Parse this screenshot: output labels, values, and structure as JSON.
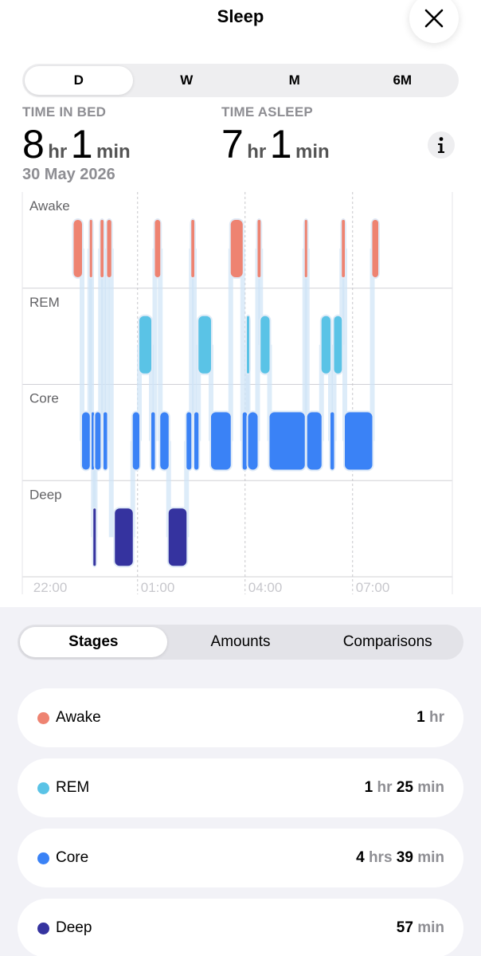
{
  "header": {
    "title": "Sleep",
    "close_icon": "close-icon"
  },
  "range_tabs": [
    {
      "label": "D",
      "active": true
    },
    {
      "label": "W",
      "active": false
    },
    {
      "label": "M",
      "active": false
    },
    {
      "label": "6M",
      "active": false
    }
  ],
  "summary": {
    "time_in_bed_label": "TIME IN BED",
    "time_in_bed_hours": "8",
    "time_in_bed_minutes": "1",
    "time_asleep_label": "TIME ASLEEP",
    "time_asleep_hours": "7",
    "time_asleep_minutes": "1",
    "unit_hr": "hr",
    "unit_min": "min",
    "date": "30 May 2026",
    "info_icon": "info-icon"
  },
  "chart_data": {
    "type": "timeline",
    "stages": [
      "Awake",
      "REM",
      "Core",
      "Deep"
    ],
    "x_ticks": [
      "22:00",
      "01:00",
      "04:00",
      "07:00"
    ],
    "colors": {
      "Awake": "#ee8371",
      "REM": "#5ac3e6",
      "Core": "#3a82f6",
      "Deep": "#35339f"
    },
    "segments": [
      {
        "stage": "Awake",
        "start": "23:13",
        "end": "23:27"
      },
      {
        "stage": "Core",
        "start": "23:27",
        "end": "23:40"
      },
      {
        "stage": "Awake",
        "start": "23:40",
        "end": "23:43"
      },
      {
        "stage": "Core",
        "start": "23:43",
        "end": "23:46"
      },
      {
        "stage": "Deep",
        "start": "23:46",
        "end": "23:49"
      },
      {
        "stage": "Core",
        "start": "23:49",
        "end": "23:58"
      },
      {
        "stage": "Awake",
        "start": "23:58",
        "end": "24:03"
      },
      {
        "stage": "Core",
        "start": "24:03",
        "end": "24:09"
      },
      {
        "stage": "Awake",
        "start": "24:09",
        "end": "24:16"
      },
      {
        "stage": "Deep",
        "start": "24:22",
        "end": "24:52"
      },
      {
        "stage": "Core",
        "start": "24:52",
        "end": "25:03"
      },
      {
        "stage": "REM",
        "start": "25:03",
        "end": "25:23"
      },
      {
        "stage": "Core",
        "start": "25:23",
        "end": "25:29"
      },
      {
        "stage": "Awake",
        "start": "25:29",
        "end": "25:38"
      },
      {
        "stage": "Core",
        "start": "25:38",
        "end": "25:52"
      },
      {
        "stage": "Deep",
        "start": "25:52",
        "end": "26:22"
      },
      {
        "stage": "Core",
        "start": "26:22",
        "end": "26:30"
      },
      {
        "stage": "Awake",
        "start": "26:30",
        "end": "26:35"
      },
      {
        "stage": "Core",
        "start": "26:35",
        "end": "26:42"
      },
      {
        "stage": "REM",
        "start": "26:42",
        "end": "27:03"
      },
      {
        "stage": "Core",
        "start": "27:03",
        "end": "27:36"
      },
      {
        "stage": "Awake",
        "start": "27:36",
        "end": "27:56"
      },
      {
        "stage": "Core",
        "start": "27:56",
        "end": "28:03"
      },
      {
        "stage": "REM",
        "start": "28:03",
        "end": "28:05"
      },
      {
        "stage": "Core",
        "start": "28:05",
        "end": "28:21"
      },
      {
        "stage": "Awake",
        "start": "28:21",
        "end": "28:26"
      },
      {
        "stage": "REM",
        "start": "28:26",
        "end": "28:41"
      },
      {
        "stage": "Core",
        "start": "28:41",
        "end": "29:40"
      },
      {
        "stage": "Awake",
        "start": "29:40",
        "end": "29:44"
      },
      {
        "stage": "Core",
        "start": "29:44",
        "end": "30:08"
      },
      {
        "stage": "REM",
        "start": "30:08",
        "end": "30:23"
      },
      {
        "stage": "Core",
        "start": "30:23",
        "end": "30:29"
      },
      {
        "stage": "REM",
        "start": "30:29",
        "end": "30:42"
      },
      {
        "stage": "Awake",
        "start": "30:42",
        "end": "30:47"
      },
      {
        "stage": "Core",
        "start": "30:47",
        "end": "31:33"
      },
      {
        "stage": "Awake",
        "start": "31:33",
        "end": "31:43"
      }
    ],
    "grid": true
  },
  "detail_tabs": [
    {
      "label": "Stages",
      "active": true
    },
    {
      "label": "Amounts",
      "active": false
    },
    {
      "label": "Comparisons",
      "active": false
    }
  ],
  "stage_rows": [
    {
      "name": "Awake",
      "color": "#ee8371",
      "parts": [
        {
          "num": "1",
          "unit": "hr"
        }
      ]
    },
    {
      "name": "REM",
      "color": "#5ac3e6",
      "parts": [
        {
          "num": "1",
          "unit": "hr"
        },
        {
          "num": "25",
          "unit": "min"
        }
      ]
    },
    {
      "name": "Core",
      "color": "#3a82f6",
      "parts": [
        {
          "num": "4",
          "unit": "hrs"
        },
        {
          "num": "39",
          "unit": "min"
        }
      ]
    },
    {
      "name": "Deep",
      "color": "#35339f",
      "parts": [
        {
          "num": "57",
          "unit": "min"
        }
      ]
    }
  ]
}
